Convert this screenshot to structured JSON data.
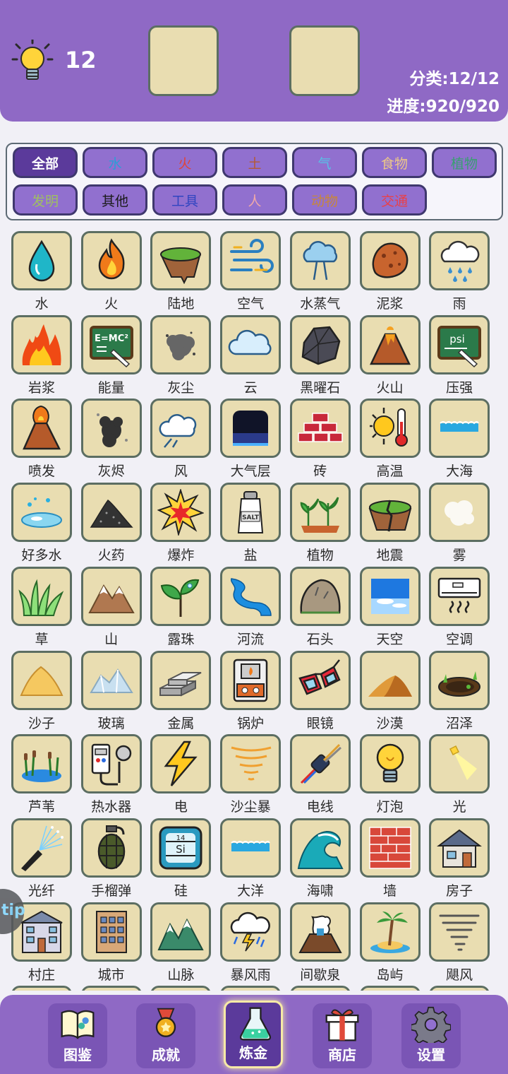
{
  "header": {
    "hint_count": "12",
    "category_progress": "分类:12/12",
    "overall_progress": "进度:920/920"
  },
  "filters": [
    {
      "label": "全部",
      "color": "#ffffff",
      "active": true
    },
    {
      "label": "水",
      "color": "#2a9fd6"
    },
    {
      "label": "火",
      "color": "#e0433a"
    },
    {
      "label": "土",
      "color": "#b45a35"
    },
    {
      "label": "气",
      "color": "#58c0e6"
    },
    {
      "label": "食物",
      "color": "#ecc788"
    },
    {
      "label": "植物",
      "color": "#38a070"
    },
    {
      "label": "发明",
      "color": "#a0c060"
    },
    {
      "label": "其他",
      "color": "#1a1a1a"
    },
    {
      "label": "工具",
      "color": "#3045c0"
    },
    {
      "label": "人",
      "color": "#f0a8a8"
    },
    {
      "label": "动物",
      "color": "#c8863a"
    },
    {
      "label": "交通",
      "color": "#e8404a"
    }
  ],
  "elements": [
    {
      "name": "水",
      "icon": "water-drop-icon"
    },
    {
      "name": "火",
      "icon": "fire-icon"
    },
    {
      "name": "陆地",
      "icon": "land-icon"
    },
    {
      "name": "空气",
      "icon": "air-icon"
    },
    {
      "name": "水蒸气",
      "icon": "steam-icon"
    },
    {
      "name": "泥浆",
      "icon": "mud-icon"
    },
    {
      "name": "雨",
      "icon": "rain-icon"
    },
    {
      "name": "岩浆",
      "icon": "lava-icon"
    },
    {
      "name": "能量",
      "icon": "energy-board-icon"
    },
    {
      "name": "灰尘",
      "icon": "dust-icon"
    },
    {
      "name": "云",
      "icon": "cloud-icon"
    },
    {
      "name": "黑曜石",
      "icon": "obsidian-icon"
    },
    {
      "name": "火山",
      "icon": "volcano-icon"
    },
    {
      "name": "压强",
      "icon": "pressure-board-icon"
    },
    {
      "name": "喷发",
      "icon": "eruption-icon"
    },
    {
      "name": "灰烬",
      "icon": "ash-icon"
    },
    {
      "name": "风",
      "icon": "wind-icon"
    },
    {
      "name": "大气层",
      "icon": "atmosphere-icon"
    },
    {
      "name": "砖",
      "icon": "brick-icon"
    },
    {
      "name": "高温",
      "icon": "heat-icon"
    },
    {
      "name": "大海",
      "icon": "sea-icon"
    },
    {
      "name": "好多水",
      "icon": "puddle-icon"
    },
    {
      "name": "火药",
      "icon": "gunpowder-icon"
    },
    {
      "name": "爆炸",
      "icon": "explosion-icon"
    },
    {
      "name": "盐",
      "icon": "salt-shaker-icon"
    },
    {
      "name": "植物",
      "icon": "plant-icon"
    },
    {
      "name": "地震",
      "icon": "earthquake-icon"
    },
    {
      "name": "雾",
      "icon": "fog-icon"
    },
    {
      "name": "草",
      "icon": "grass-icon"
    },
    {
      "name": "山",
      "icon": "mountain-icon"
    },
    {
      "name": "露珠",
      "icon": "dew-icon"
    },
    {
      "name": "河流",
      "icon": "river-icon"
    },
    {
      "name": "石头",
      "icon": "stone-icon"
    },
    {
      "name": "天空",
      "icon": "sky-icon"
    },
    {
      "name": "空调",
      "icon": "air-conditioner-icon"
    },
    {
      "name": "沙子",
      "icon": "sand-icon"
    },
    {
      "name": "玻璃",
      "icon": "glass-icon"
    },
    {
      "name": "金属",
      "icon": "metal-bars-icon"
    },
    {
      "name": "锅炉",
      "icon": "boiler-icon"
    },
    {
      "name": "眼镜",
      "icon": "glasses-icon"
    },
    {
      "name": "沙漠",
      "icon": "desert-icon"
    },
    {
      "name": "沼泽",
      "icon": "swamp-icon"
    },
    {
      "name": "芦苇",
      "icon": "reed-icon"
    },
    {
      "name": "热水器",
      "icon": "water-heater-icon"
    },
    {
      "name": "电",
      "icon": "lightning-icon"
    },
    {
      "name": "沙尘暴",
      "icon": "sandstorm-icon"
    },
    {
      "name": "电线",
      "icon": "wire-icon"
    },
    {
      "name": "灯泡",
      "icon": "light-bulb-icon"
    },
    {
      "name": "光",
      "icon": "light-beam-icon"
    },
    {
      "name": "光纤",
      "icon": "optical-fiber-icon"
    },
    {
      "name": "手榴弹",
      "icon": "grenade-icon"
    },
    {
      "name": "硅",
      "icon": "silicon-icon",
      "glyph_number": "14",
      "glyph_symbol": "Si"
    },
    {
      "name": "大洋",
      "icon": "ocean-icon"
    },
    {
      "name": "海啸",
      "icon": "tsunami-icon"
    },
    {
      "name": "墙",
      "icon": "wall-icon"
    },
    {
      "name": "房子",
      "icon": "house-icon"
    },
    {
      "name": "村庄",
      "icon": "village-icon"
    },
    {
      "name": "城市",
      "icon": "city-icon"
    },
    {
      "name": "山脉",
      "icon": "mountain-range-icon"
    },
    {
      "name": "暴风雨",
      "icon": "storm-icon"
    },
    {
      "name": "间歇泉",
      "icon": "geyser-icon"
    },
    {
      "name": "岛屿",
      "icon": "island-icon"
    },
    {
      "name": "飓风",
      "icon": "hurricane-icon"
    }
  ],
  "side_tab_label": "tip",
  "nav": [
    {
      "label": "图鉴",
      "icon": "book-icon"
    },
    {
      "label": "成就",
      "icon": "medal-icon"
    },
    {
      "label": "炼金",
      "icon": "flask-icon",
      "active": true
    },
    {
      "label": "商店",
      "icon": "gift-icon"
    },
    {
      "label": "设置",
      "icon": "gear-icon"
    }
  ]
}
